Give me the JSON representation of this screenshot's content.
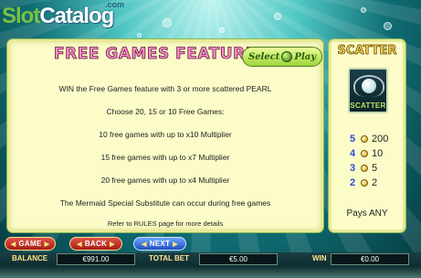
{
  "logo": {
    "slot": "Slot",
    "catalog": "Catalog",
    "com": ".com"
  },
  "panel": {
    "title": "FREE GAMES FEATURE",
    "badge_left": "Select",
    "badge_right": "Play",
    "lines": [
      "WIN the Free Games feature with 3 or more scattered PEARL",
      "Choose 20, 15 or 10 Free Games:",
      "10 free games with up to x10 Multiplier",
      "15 free games with up to x7 Multiplier",
      "20 free games with up to x4 Multiplier",
      "The Mermaid Special Substitute can occur during free games",
      "Refer to RULES page for more details"
    ]
  },
  "scatter": {
    "title": "SCATTER",
    "symbol_label": "SCATTER",
    "pays": [
      {
        "count": "5",
        "payout": "200"
      },
      {
        "count": "4",
        "payout": "10"
      },
      {
        "count": "3",
        "payout": "5"
      },
      {
        "count": "2",
        "payout": "2"
      }
    ],
    "pays_any": "Pays ANY"
  },
  "buttons": {
    "game": "GAME",
    "back": "BACK",
    "next": "NEXT"
  },
  "footer": {
    "balance_label": "BALANCE",
    "balance_value": "€991.00",
    "total_bet_label": "TOTAL BET",
    "total_bet_value": "€5.00",
    "win_label": "WIN",
    "win_value": "€0.00"
  },
  "colors": {
    "panel_bg": "#fbfcc8",
    "title_pink": "#ff8fc6",
    "scatter_gold": "#ffd84a",
    "button_red": "#c0261c",
    "button_blue": "#2f63d6"
  }
}
